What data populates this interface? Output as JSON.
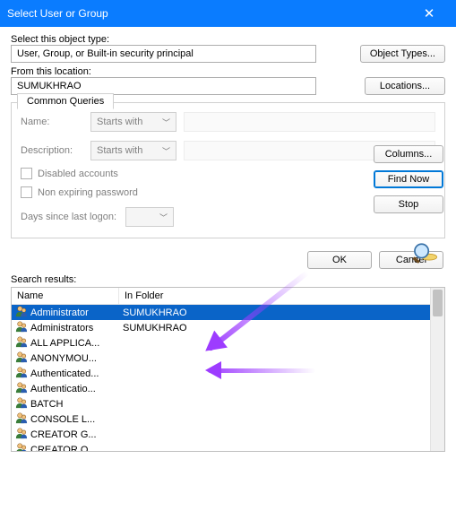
{
  "title": "Select User or Group",
  "object_type_label": "Select this object type:",
  "object_type_value": "User, Group, or Built-in security principal",
  "object_types_btn": "Object Types...",
  "location_label": "From this location:",
  "location_value": "SUMUKHRAO",
  "locations_btn": "Locations...",
  "tab_label": "Common Queries",
  "queries": {
    "name_label": "Name:",
    "desc_label": "Description:",
    "starts_with": "Starts with",
    "disabled_label": "Disabled accounts",
    "nonexp_label": "Non expiring password",
    "days_label": "Days since last logon:"
  },
  "side_buttons": {
    "columns": "Columns...",
    "find_now": "Find Now",
    "stop": "Stop"
  },
  "footer": {
    "ok": "OK",
    "cancel": "Cancel"
  },
  "results_label": "Search results:",
  "results_head": {
    "name": "Name",
    "folder": "In Folder"
  },
  "results": [
    {
      "name": "Administrator",
      "folder": "SUMUKHRAO",
      "selected": true
    },
    {
      "name": "Administrators",
      "folder": "SUMUKHRAO",
      "selected": false
    },
    {
      "name": "ALL APPLICA...",
      "folder": "",
      "selected": false
    },
    {
      "name": "ANONYMOU...",
      "folder": "",
      "selected": false
    },
    {
      "name": "Authenticated...",
      "folder": "",
      "selected": false
    },
    {
      "name": "Authenticatio...",
      "folder": "",
      "selected": false
    },
    {
      "name": "BATCH",
      "folder": "",
      "selected": false
    },
    {
      "name": "CONSOLE L...",
      "folder": "",
      "selected": false
    },
    {
      "name": "CREATOR G...",
      "folder": "",
      "selected": false
    },
    {
      "name": "CREATOR O...",
      "folder": "",
      "selected": false
    }
  ]
}
